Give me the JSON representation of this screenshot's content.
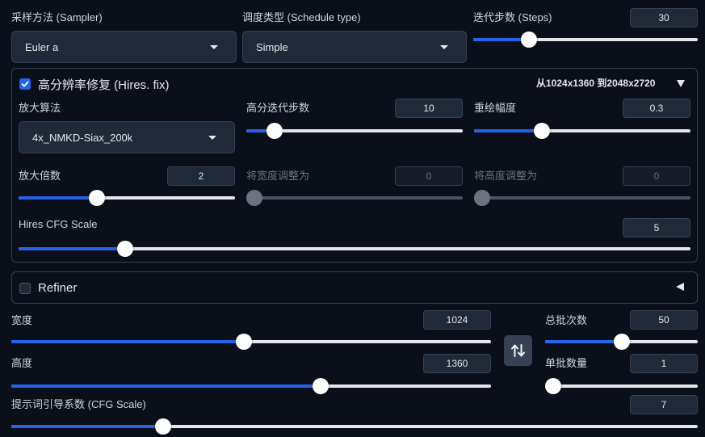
{
  "sampler": {
    "label": "采样方法 (Sampler)",
    "value": "Euler a"
  },
  "schedule": {
    "label": "调度类型 (Schedule type)",
    "value": "Simple"
  },
  "steps": {
    "label": "迭代步数 (Steps)",
    "value": "30",
    "fraction": 0.23
  },
  "hires": {
    "title": "高分辨率修复 (Hires. fix)",
    "checked": true,
    "resolution_info": "从1024x1360 到2048x2720",
    "upscaler": {
      "label": "放大算法",
      "value": "4x_NMKD-Siax_200k"
    },
    "hires_steps": {
      "label": "高分迭代步数",
      "value": "10",
      "fraction": 0.1
    },
    "denoise": {
      "label": "重绘幅度",
      "value": "0.3",
      "fraction": 0.3
    },
    "upscale_by": {
      "label": "放大倍数",
      "value": "2",
      "fraction": 0.35
    },
    "resize_width": {
      "label": "将宽度调整为",
      "value": "0",
      "fraction": 0
    },
    "resize_height": {
      "label": "将高度调整为",
      "value": "0",
      "fraction": 0
    },
    "cfg": {
      "label": "Hires CFG Scale",
      "value": "5",
      "fraction": 0.15
    }
  },
  "refiner": {
    "title": "Refiner",
    "checked": false
  },
  "width": {
    "label": "宽度",
    "value": "1024",
    "fraction": 0.485
  },
  "height": {
    "label": "高度",
    "value": "1360",
    "fraction": 0.65
  },
  "batch_count": {
    "label": "总批次数",
    "value": "50",
    "fraction": 0.5
  },
  "batch_size": {
    "label": "单批数量",
    "value": "1",
    "fraction": 0
  },
  "cfg_scale": {
    "label": "提示词引导系数 (CFG Scale)",
    "value": "7",
    "fraction": 0.215
  },
  "icons": {
    "swap": "swap-vertical-icon",
    "collapse": "triangle-down-icon",
    "expand": "triangle-left-icon"
  },
  "colors": {
    "accent": "#2563eb",
    "background": "#0b0f19",
    "input": "#1f2937"
  }
}
